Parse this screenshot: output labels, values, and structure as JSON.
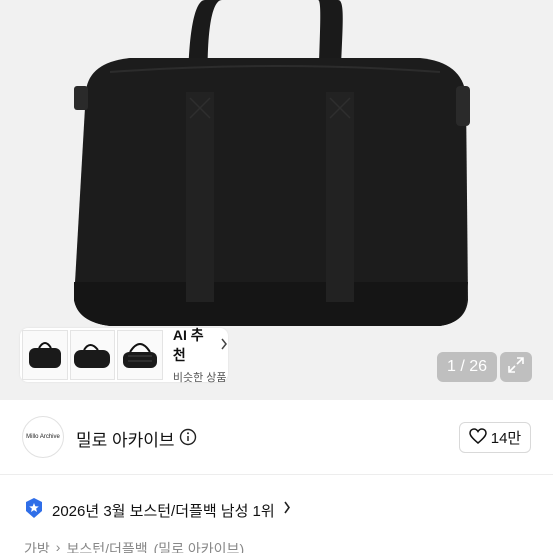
{
  "gallery": {
    "counter": "1 / 26",
    "ai_recommend": {
      "title": "AI 추천",
      "subtitle": "비슷한 상품"
    },
    "thumbnails": [
      "black-duffel-bag",
      "black-duffel-bag-angle",
      "black-duffel-bag-quilted"
    ]
  },
  "seller": {
    "avatar_text": "Millo Archive",
    "name": "밀로 아카이브",
    "like_count": "14만"
  },
  "rank": {
    "text": "2026년 3월 보스턴/더플백 남성 1위"
  },
  "breadcrumb": {
    "items": [
      "가방",
      "보스턴/더플백",
      "(밀로 아카이브)"
    ]
  },
  "colors": {
    "hero_bg": "#f1f1f1",
    "bag": "#1b1b1b",
    "badge_blue": "#2f6ee8"
  }
}
